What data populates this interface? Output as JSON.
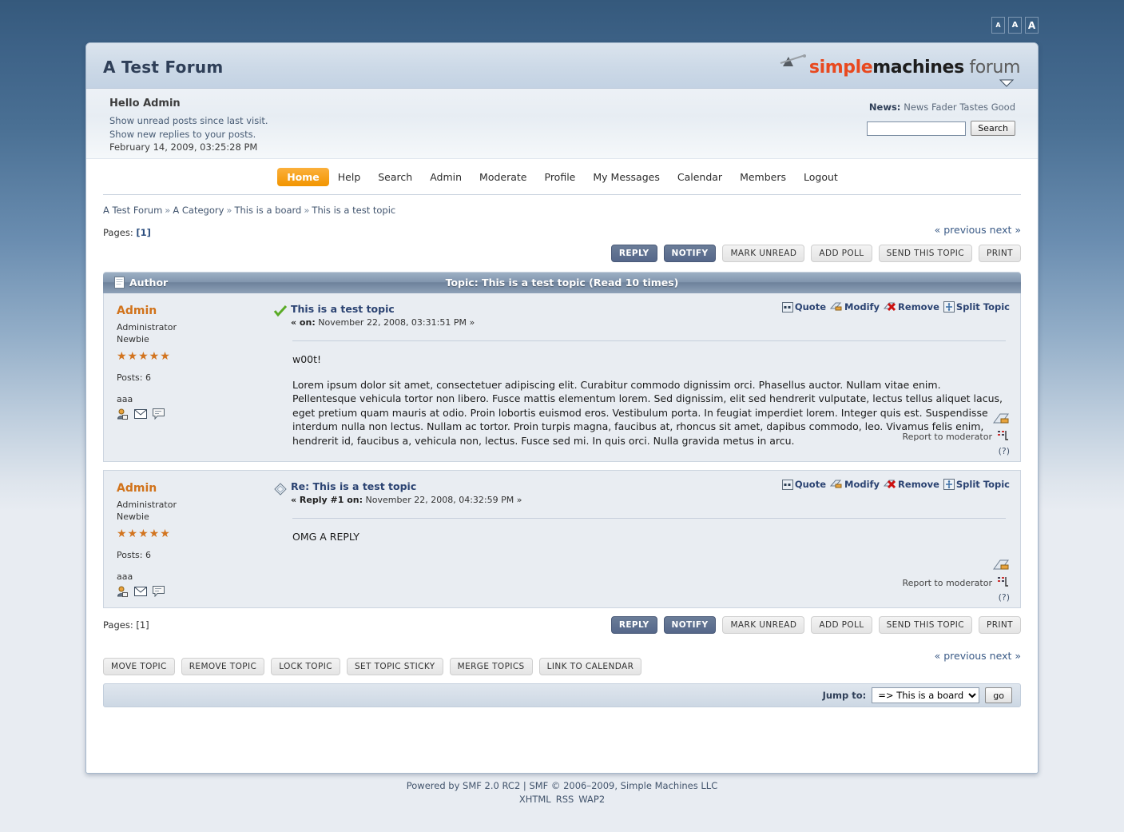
{
  "topbar": {
    "font_sizers": [
      "A",
      "A",
      "A"
    ]
  },
  "header": {
    "forum_title": "A Test Forum",
    "logo": {
      "part1": "simple",
      "part2": "machines",
      "part3": " forum"
    }
  },
  "user_area": {
    "greeting": "Hello Admin",
    "links": [
      "Show unread posts since last visit.",
      "Show new replies to your posts."
    ],
    "date": "February 14, 2009, 03:25:28 PM",
    "news_label": "News:",
    "news_text": "News Fader Tastes Good",
    "search_value": "",
    "search_placeholder": "",
    "search_button": "Search"
  },
  "nav": {
    "items": [
      {
        "label": "Home",
        "active": true
      },
      {
        "label": "Help",
        "active": false
      },
      {
        "label": "Search",
        "active": false
      },
      {
        "label": "Admin",
        "active": false
      },
      {
        "label": "Moderate",
        "active": false
      },
      {
        "label": "Profile",
        "active": false
      },
      {
        "label": "My Messages",
        "active": false
      },
      {
        "label": "Calendar",
        "active": false
      },
      {
        "label": "Members",
        "active": false
      },
      {
        "label": "Logout",
        "active": false
      }
    ]
  },
  "breadcrumb": {
    "items": [
      "A Test Forum",
      "A Category",
      "This is a board",
      "This is a test topic"
    ],
    "separator": "»"
  },
  "pagination": {
    "label": "Pages:",
    "current": "[1]",
    "previous": "« previous",
    "next": "next »"
  },
  "topic_buttons": [
    {
      "label": "REPLY",
      "primary": true
    },
    {
      "label": "NOTIFY",
      "primary": true
    },
    {
      "label": "MARK UNREAD",
      "primary": false
    },
    {
      "label": "ADD POLL",
      "primary": false
    },
    {
      "label": "SEND THIS TOPIC",
      "primary": false
    },
    {
      "label": "PRINT",
      "primary": false
    }
  ],
  "topic_header": {
    "author_column": "Author",
    "topic_column": "Topic: This is a test topic  (Read 10 times)"
  },
  "posts": [
    {
      "author": {
        "name": "Admin",
        "role": "Administrator",
        "rank": "Newbie",
        "stars": "★★★★★",
        "posts": "Posts: 6",
        "signature": "aaa"
      },
      "subject": "This is a test topic",
      "date_prefix": "« on:",
      "date": "November 22, 2008, 03:31:51 PM »",
      "actions": [
        "Quote",
        "Modify",
        "Remove",
        "Split Topic"
      ],
      "paragraphs": [
        "w00t!",
        "Lorem ipsum dolor sit amet, consectetuer adipiscing elit. Curabitur commodo dignissim orci. Phasellus auctor. Nullam vitae enim. Pellentesque vehicula tortor non libero. Fusce mattis elementum lorem. Sed dignissim, elit sed hendrerit vulputate, lectus tellus aliquet lacus, eget pretium quam mauris at odio. Proin lobortis euismod eros. Vestibulum porta. In feugiat imperdiet lorem. Integer quis est. Suspendisse interdum nulla non lectus. Nullam ac tortor. Proin turpis magna, faucibus at, rhoncus sit amet, dapibus commodo, leo. Vivamus felis enim, hendrerit id, faucibus a, vehicula non, lectus. Fusce sed mi. In quis orci. Nulla gravida metus in arcu."
      ],
      "report_label": "Report to moderator",
      "logged_label": "(?)"
    },
    {
      "author": {
        "name": "Admin",
        "role": "Administrator",
        "rank": "Newbie",
        "stars": "★★★★★",
        "posts": "Posts: 6",
        "signature": "aaa"
      },
      "subject": "Re: This is a test topic",
      "date_prefix": "« Reply #1 on:",
      "date": "November 22, 2008, 04:32:59 PM »",
      "actions": [
        "Quote",
        "Modify",
        "Remove",
        "Split Topic"
      ],
      "paragraphs": [
        "OMG A REPLY"
      ],
      "report_label": "Report to moderator",
      "logged_label": "(?)"
    }
  ],
  "mod_buttons": [
    "MOVE TOPIC",
    "REMOVE TOPIC",
    "LOCK TOPIC",
    "SET TOPIC STICKY",
    "MERGE TOPICS",
    "LINK TO CALENDAR"
  ],
  "jump_to": {
    "label": "Jump to:",
    "selected": "=> This is a board",
    "options": [
      "=> This is a board"
    ],
    "go_label": "go"
  },
  "footer": {
    "line1": "Powered by SMF 2.0 RC2 | SMF © 2006–2009, Simple Machines LLC",
    "links": [
      "XHTML",
      "RSS",
      "WAP2"
    ]
  },
  "colors": {
    "accent_orange": "#d1731b",
    "nav_active": "#f5a01e",
    "link_blue": "#2b4372",
    "page_bg_top": "#35597c",
    "page_bg_bottom": "#e8ecf2"
  }
}
